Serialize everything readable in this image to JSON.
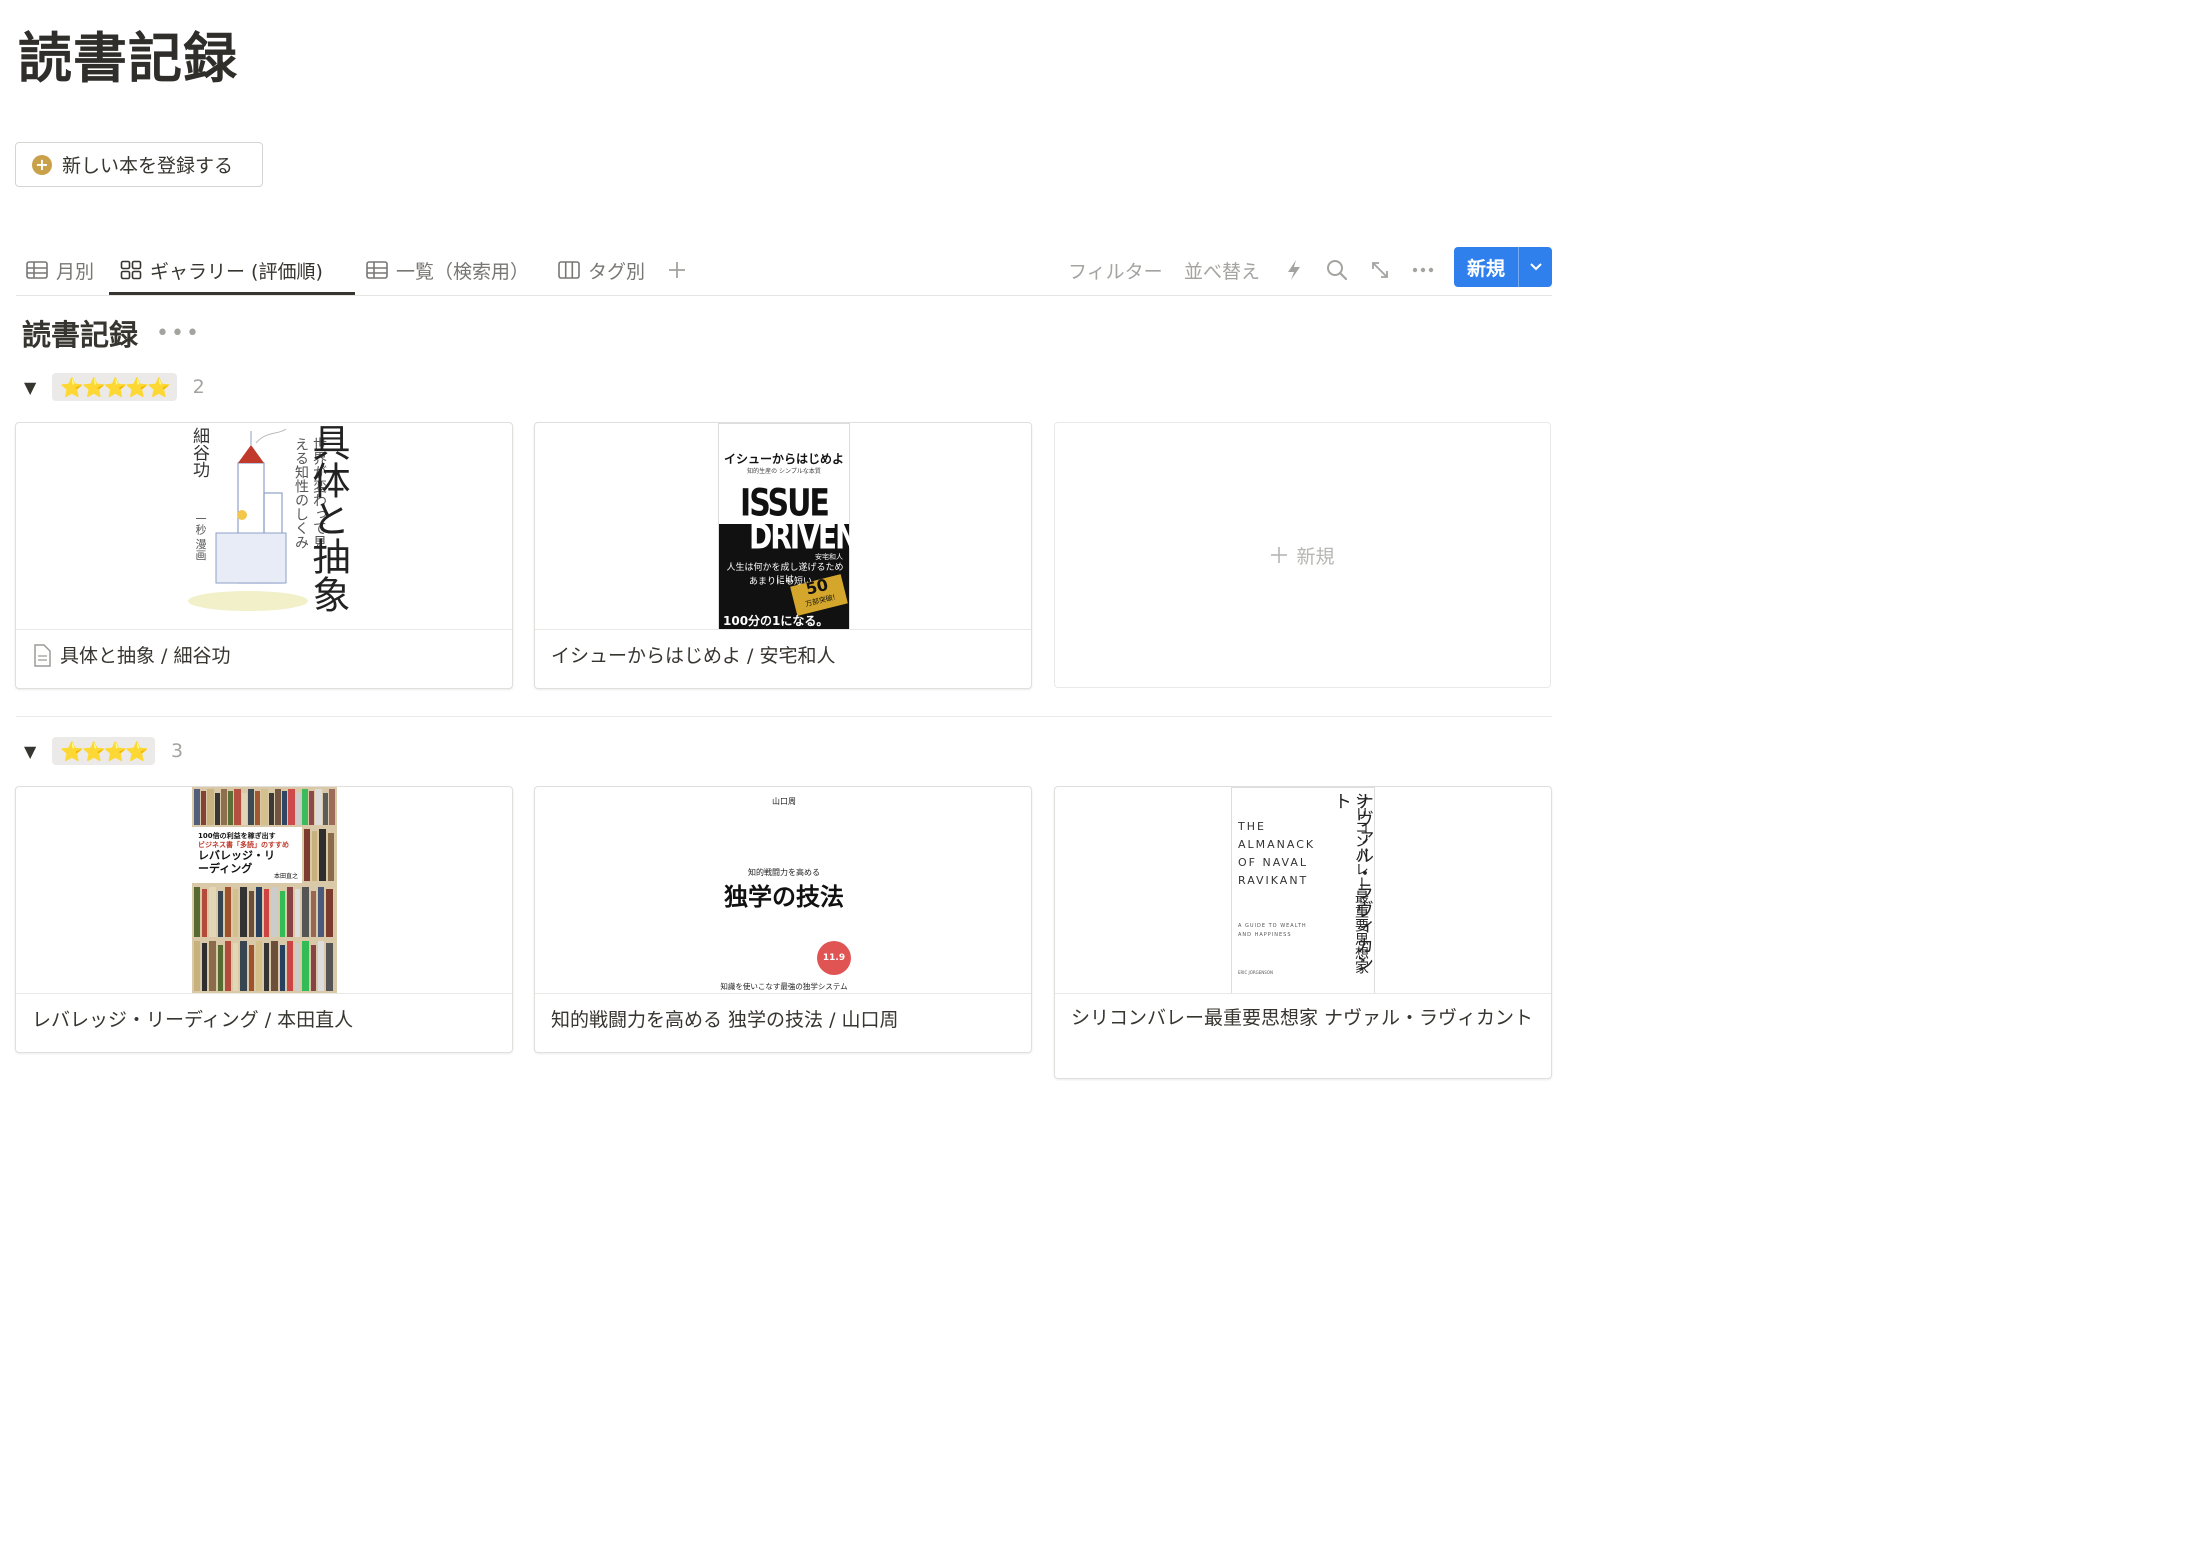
{
  "page": {
    "title": "読書記録"
  },
  "new_book_button": {
    "label": "新しい本を登録する"
  },
  "tabs": [
    {
      "label": "月別",
      "icon": "table-icon"
    },
    {
      "label": "ギャラリー (評価順)",
      "icon": "gallery-icon"
    },
    {
      "label": "一覧（検索用）",
      "icon": "table-icon"
    },
    {
      "label": "タグ別",
      "icon": "board-icon"
    }
  ],
  "toolbar": {
    "filter_label": "フィルター",
    "sort_label": "並べ替え",
    "new_button_label": "新規"
  },
  "database": {
    "title": "読書記録",
    "more": "•••"
  },
  "groups": [
    {
      "stars": "⭐⭐⭐⭐⭐",
      "count": "2",
      "cards": [
        {
          "caption": "具体と抽象 / 細谷功",
          "cover_title": "具体と抽象",
          "cover_subtitle": "世界が変わって見える知性のしくみ",
          "cover_author": "細谷功",
          "cover_illustrator": "一秒 漫画"
        },
        {
          "caption": "イシューからはじめよ / 安宅和人",
          "cover_title": "イシューからはじめよ",
          "cover_sub": "知的生産の シンプルな本質",
          "cover_big1": "ISSUE",
          "cover_big2": "DRIVEN",
          "cover_author": "安宅和人",
          "cover_line1": "人生は何かを成し遂げるためには",
          "cover_line2": "あまりにも短い。",
          "cover_badge": "50",
          "cover_badge_sub": "万部突破!",
          "cover_bottom": "100分の1になる。"
        }
      ],
      "add_label": "新規"
    },
    {
      "stars": "⭐⭐⭐⭐",
      "count": "3",
      "cards": [
        {
          "caption": "レバレッジ・リーディング / 本田直人",
          "cover_top": "100倍の利益を稼ぎ出す",
          "cover_mid": "ビジネス書「多読」のすすめ",
          "cover_title": "レバレッジ・リーディング",
          "cover_author": "本田直之"
        },
        {
          "caption": "知的戦闘力を高める 独学の技法  / 山口周",
          "cover_author": "山口周",
          "cover_kicker": "知的戦闘力を高める",
          "cover_title": "独学の技法",
          "cover_badge": "11.9",
          "cover_bottom": "知識を使いこなす最強の独学システム"
        },
        {
          "caption": "シリコンバレー最重要思想家 ナヴァル・ラヴィカント",
          "cover_en": "THE ALMANACK OF NAVAL RAVIKANT",
          "cover_en_sub": "A GUIDE TO WEALTH AND HAPPINESS",
          "cover_jp": "シリコンバレー最重要思想家",
          "cover_jp2": "ナヴァル・ラヴィカント",
          "cover_author": "ERIC JORGENSON"
        }
      ]
    }
  ],
  "colors": {
    "accent": "#2f80ed",
    "plus_gold": "#c9a14a",
    "star": "#f0b800"
  }
}
